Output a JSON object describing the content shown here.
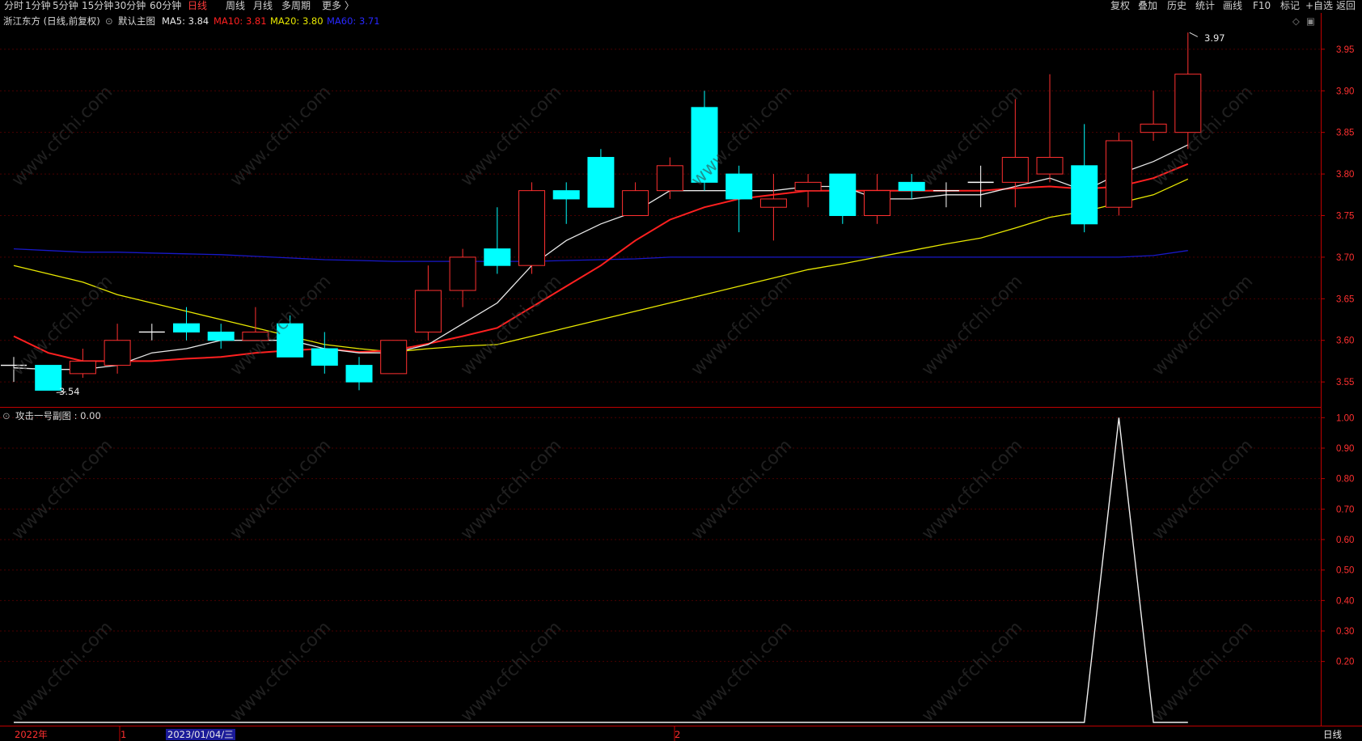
{
  "toolbar": {
    "left": [
      "分时",
      "1分钟",
      "5分钟",
      "15分钟",
      "30分钟",
      "60分钟",
      "日线",
      "周线",
      "月线",
      "多周期",
      "更多 〉"
    ],
    "active": "日线",
    "right": [
      "复权",
      "叠加",
      "历史",
      "统计",
      "画线",
      "F10",
      "标记",
      "+自选",
      "返回"
    ]
  },
  "main_panel": {
    "title": "浙江东方 (日线,前复权)",
    "indicator_name": "默认主图",
    "ma_labels": [
      {
        "text": "MA5: 3.84",
        "color": "#e8e8e8"
      },
      {
        "text": "MA10: 3.81",
        "color": "#ff2020"
      },
      {
        "text": "MA20: 3.80",
        "color": "#e8e800"
      },
      {
        "text": "MA60: 3.71",
        "color": "#2222ff"
      }
    ],
    "high_label": "3.97",
    "low_label": "3.54"
  },
  "sub_panel": {
    "title": "攻击一号副图 : 0.00"
  },
  "bottom": {
    "year_label": "2022年",
    "month1_label": "1",
    "cursor_date": "2023/01/04/三",
    "month2_label": "2",
    "period_button": "日线"
  },
  "watermark": "www.cfchi.com",
  "colors": {
    "up": "#ff3030",
    "down": "#00ffff",
    "ma5": "#e8e8e8",
    "ma10": "#ff2020",
    "ma20": "#e8e800",
    "ma60": "#1818c8",
    "axis": "#c00000",
    "grid": "#4a0000"
  },
  "chart_data": {
    "type": "candlestick",
    "y_ticks": [
      3.55,
      3.6,
      3.65,
      3.7,
      3.75,
      3.8,
      3.85,
      3.9,
      3.95
    ],
    "ylim": [
      3.52,
      3.98
    ],
    "candles": [
      {
        "o": 3.57,
        "c": 3.57,
        "h": 3.58,
        "l": 3.55
      },
      {
        "o": 3.57,
        "c": 3.54,
        "h": 3.57,
        "l": 3.54
      },
      {
        "o": 3.56,
        "c": 3.575,
        "h": 3.59,
        "l": 3.555
      },
      {
        "o": 3.57,
        "c": 3.6,
        "h": 3.62,
        "l": 3.56
      },
      {
        "o": 3.61,
        "c": 3.61,
        "h": 3.62,
        "l": 3.6
      },
      {
        "o": 3.62,
        "c": 3.61,
        "h": 3.64,
        "l": 3.6
      },
      {
        "o": 3.61,
        "c": 3.6,
        "h": 3.62,
        "l": 3.59
      },
      {
        "o": 3.6,
        "c": 3.61,
        "h": 3.64,
        "l": 3.6
      },
      {
        "o": 3.62,
        "c": 3.58,
        "h": 3.63,
        "l": 3.58
      },
      {
        "o": 3.59,
        "c": 3.57,
        "h": 3.61,
        "l": 3.56
      },
      {
        "o": 3.57,
        "c": 3.55,
        "h": 3.58,
        "l": 3.54
      },
      {
        "o": 3.56,
        "c": 3.6,
        "h": 3.6,
        "l": 3.56
      },
      {
        "o": 3.61,
        "c": 3.66,
        "h": 3.69,
        "l": 3.6
      },
      {
        "o": 3.66,
        "c": 3.7,
        "h": 3.71,
        "l": 3.64
      },
      {
        "o": 3.71,
        "c": 3.69,
        "h": 3.76,
        "l": 3.68
      },
      {
        "o": 3.69,
        "c": 3.78,
        "h": 3.79,
        "l": 3.68
      },
      {
        "o": 3.78,
        "c": 3.77,
        "h": 3.79,
        "l": 3.74
      },
      {
        "o": 3.82,
        "c": 3.76,
        "h": 3.83,
        "l": 3.76
      },
      {
        "o": 3.75,
        "c": 3.78,
        "h": 3.79,
        "l": 3.75
      },
      {
        "o": 3.78,
        "c": 3.81,
        "h": 3.82,
        "l": 3.77
      },
      {
        "o": 3.88,
        "c": 3.79,
        "h": 3.9,
        "l": 3.78
      },
      {
        "o": 3.8,
        "c": 3.77,
        "h": 3.81,
        "l": 3.73
      },
      {
        "o": 3.76,
        "c": 3.77,
        "h": 3.8,
        "l": 3.72
      },
      {
        "o": 3.78,
        "c": 3.79,
        "h": 3.8,
        "l": 3.76
      },
      {
        "o": 3.8,
        "c": 3.75,
        "h": 3.8,
        "l": 3.74
      },
      {
        "o": 3.75,
        "c": 3.78,
        "h": 3.8,
        "l": 3.74
      },
      {
        "o": 3.79,
        "c": 3.78,
        "h": 3.8,
        "l": 3.77
      },
      {
        "o": 3.78,
        "c": 3.78,
        "h": 3.79,
        "l": 3.76
      },
      {
        "o": 3.79,
        "c": 3.79,
        "h": 3.81,
        "l": 3.76
      },
      {
        "o": 3.79,
        "c": 3.82,
        "h": 3.89,
        "l": 3.76
      },
      {
        "o": 3.8,
        "c": 3.82,
        "h": 3.92,
        "l": 3.79
      },
      {
        "o": 3.81,
        "c": 3.74,
        "h": 3.86,
        "l": 3.73
      },
      {
        "o": 3.76,
        "c": 3.84,
        "h": 3.85,
        "l": 3.75
      },
      {
        "o": 3.85,
        "c": 3.86,
        "h": 3.9,
        "l": 3.84
      },
      {
        "o": 3.85,
        "c": 3.92,
        "h": 3.97,
        "l": 3.83
      }
    ],
    "ma5": [
      3.567,
      3.565,
      3.565,
      3.57,
      3.585,
      3.59,
      3.6,
      3.6,
      3.6,
      3.59,
      3.585,
      3.585,
      3.595,
      3.62,
      3.645,
      3.69,
      3.72,
      3.74,
      3.755,
      3.78,
      3.78,
      3.78,
      3.78,
      3.785,
      3.785,
      3.77,
      3.77,
      3.775,
      3.775,
      3.785,
      3.795,
      3.78,
      3.8,
      3.815,
      3.835
    ],
    "ma10": [
      3.605,
      3.585,
      3.575,
      3.575,
      3.575,
      3.578,
      3.58,
      3.585,
      3.588,
      3.59,
      3.586,
      3.588,
      3.596,
      3.605,
      3.615,
      3.64,
      3.665,
      3.69,
      3.72,
      3.745,
      3.76,
      3.77,
      3.775,
      3.78,
      3.78,
      3.78,
      3.78,
      3.78,
      3.78,
      3.783,
      3.785,
      3.782,
      3.785,
      3.795,
      3.812
    ],
    "ma20": [
      3.69,
      3.68,
      3.67,
      3.655,
      3.645,
      3.635,
      3.625,
      3.615,
      3.605,
      3.595,
      3.59,
      3.586,
      3.59,
      3.593,
      3.595,
      3.605,
      3.615,
      3.625,
      3.635,
      3.645,
      3.655,
      3.665,
      3.675,
      3.685,
      3.692,
      3.7,
      3.708,
      3.716,
      3.723,
      3.735,
      3.748,
      3.755,
      3.765,
      3.775,
      3.794
    ],
    "ma60": [
      3.71,
      3.708,
      3.706,
      3.706,
      3.705,
      3.704,
      3.703,
      3.701,
      3.699,
      3.697,
      3.696,
      3.695,
      3.695,
      3.695,
      3.695,
      3.695,
      3.696,
      3.697,
      3.698,
      3.7,
      3.7,
      3.7,
      3.7,
      3.7,
      3.7,
      3.7,
      3.7,
      3.7,
      3.7,
      3.7,
      3.7,
      3.7,
      3.7,
      3.702,
      3.708
    ],
    "sub": {
      "y_ticks": [
        0.2,
        0.3,
        0.4,
        0.5,
        0.6,
        0.7,
        0.8,
        0.9,
        1.0
      ],
      "ylim": [
        0,
        1.03
      ],
      "values": [
        0,
        0,
        0,
        0,
        0,
        0,
        0,
        0,
        0,
        0,
        0,
        0,
        0,
        0,
        0,
        0,
        0,
        0,
        0,
        0,
        0,
        0,
        0,
        0,
        0,
        0,
        0,
        0,
        0,
        0,
        0,
        0,
        1,
        0,
        0
      ]
    }
  }
}
